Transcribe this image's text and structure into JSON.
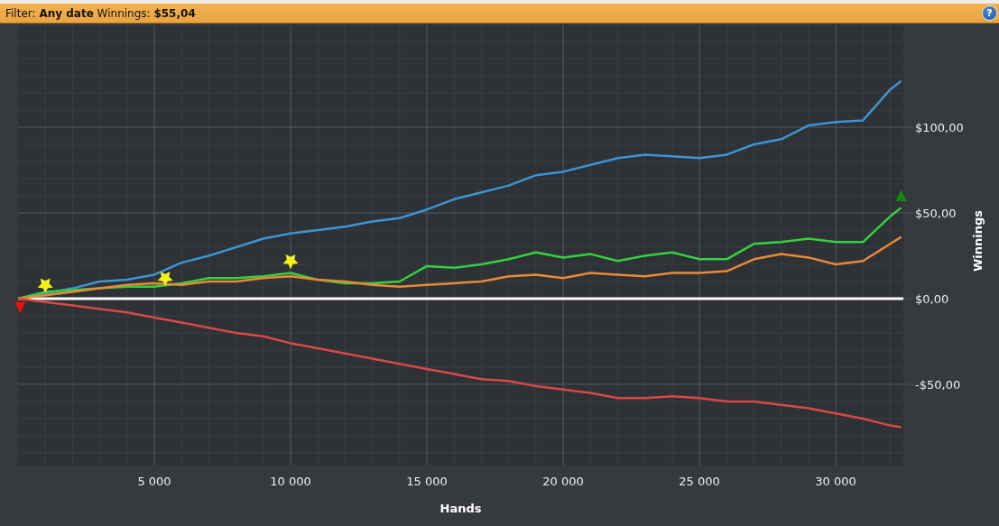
{
  "header": {
    "text": "Filter: **Any date** Winnings: **$55,04**",
    "help_button": "?"
  },
  "chart": {
    "chart_data": {
      "type": "line",
      "xlabel": "Hands",
      "ylabel": "Winnings",
      "x": [
        0,
        1000,
        2000,
        3000,
        4000,
        5000,
        6000,
        7000,
        8000,
        9000,
        10000,
        11000,
        12000,
        13000,
        14000,
        15000,
        16000,
        17000,
        18000,
        19000,
        20000,
        21000,
        22000,
        23000,
        24000,
        25000,
        26000,
        27000,
        28000,
        29000,
        30000,
        31000,
        32000,
        32400
      ],
      "series": [
        {
          "color": "#3a95d2",
          "values": [
            0,
            3,
            6,
            10,
            11,
            14,
            21,
            25,
            30,
            35,
            38,
            40,
            42,
            45,
            47,
            52,
            58,
            62,
            66,
            72,
            74,
            78,
            82,
            84,
            83,
            82,
            84,
            90,
            93,
            101,
            103,
            104,
            122,
            127
          ]
        },
        {
          "color": "#33d13e",
          "values": [
            0,
            4,
            5,
            6,
            7,
            7,
            9,
            12,
            12,
            13,
            15,
            11,
            9,
            9,
            10,
            19,
            18,
            20,
            23,
            27,
            24,
            26,
            22,
            25,
            27,
            23,
            23,
            32,
            33,
            35,
            33,
            33,
            48,
            53
          ]
        },
        {
          "color": "#e88a35",
          "values": [
            0,
            2,
            4,
            6,
            8,
            9,
            8,
            10,
            10,
            12,
            13,
            11,
            10,
            8,
            7,
            8,
            9,
            10,
            13,
            14,
            12,
            15,
            14,
            13,
            15,
            15,
            16,
            23,
            26,
            24,
            20,
            22,
            32,
            36
          ]
        },
        {
          "color": "#d94848",
          "values": [
            0,
            -2,
            -4,
            -6,
            -8,
            -11,
            -14,
            -17,
            -20,
            -22,
            -26,
            -29,
            -32,
            -35,
            -38,
            -41,
            -44,
            -47,
            -48,
            -51,
            -53,
            -55,
            -58,
            -58,
            -57,
            -58,
            -60,
            -60,
            -62,
            -64,
            -67,
            -70,
            -74,
            -75
          ]
        }
      ],
      "xlim": [
        0,
        32480
      ],
      "ylim": [
        -97.4,
        159.5
      ],
      "xticks": [
        {
          "value": 5000,
          "label": "5 000"
        },
        {
          "value": 10000,
          "label": "10 000"
        },
        {
          "value": 15000,
          "label": "15 000"
        },
        {
          "value": 20000,
          "label": "20 000"
        },
        {
          "value": 25000,
          "label": "25 000"
        },
        {
          "value": 30000,
          "label": "30 000"
        }
      ],
      "yticks": [
        {
          "value": -50,
          "label": "-$50,00"
        },
        {
          "value": 0,
          "label": "$0,00"
        },
        {
          "value": 50,
          "label": "$50,00"
        },
        {
          "value": 100,
          "label": "$100,00"
        }
      ],
      "grid": true
    },
    "markers": [
      {
        "kind": "triangle-down",
        "color": "#e81010"
      },
      {
        "kind": "star",
        "color": "#f5f01a"
      },
      {
        "kind": "star",
        "color": "#f5f01a"
      },
      {
        "kind": "star",
        "color": "#f5f01a"
      },
      {
        "kind": "triangle-up",
        "color": "#138a13"
      }
    ]
  }
}
